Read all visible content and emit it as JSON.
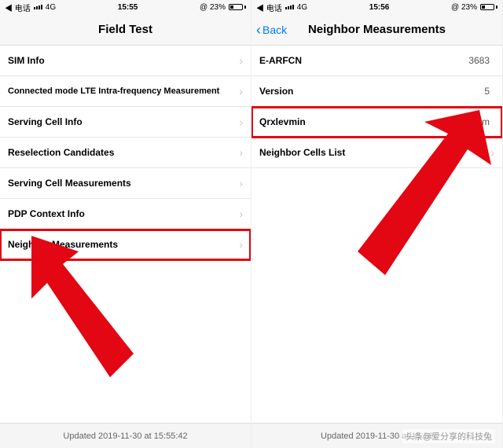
{
  "left": {
    "status": {
      "back_app": "◀ 电话",
      "signal": "4G",
      "time": "15:55",
      "batt_pct": "23%"
    },
    "title": "Field Test",
    "rows": [
      {
        "label": "SIM Info"
      },
      {
        "label": "Connected mode LTE Intra-frequency Measurement"
      },
      {
        "label": "Serving Cell Info"
      },
      {
        "label": "Reselection Candidates"
      },
      {
        "label": "Serving Cell Measurements"
      },
      {
        "label": "PDP Context Info"
      },
      {
        "label": "Neighbor Measurements"
      }
    ],
    "footer": "Updated 2019-11-30 at 15:55:42"
  },
  "right": {
    "status": {
      "back_app": "◀ 电话",
      "signal": "4G",
      "time": "15:56",
      "batt_pct": "23%"
    },
    "back_label": "Back",
    "title": "Neighbor Measurements",
    "rows": [
      {
        "label": "E-ARFCN",
        "value": "3683"
      },
      {
        "label": "Version",
        "value": "5"
      },
      {
        "label": "Qrxlevmin",
        "value": "-140 dBm"
      },
      {
        "label": "Neighbor Cells List"
      }
    ],
    "footer": "Updated 2019-11-30 at 15:56"
  },
  "watermark": "头条@爱分享的科技兔"
}
